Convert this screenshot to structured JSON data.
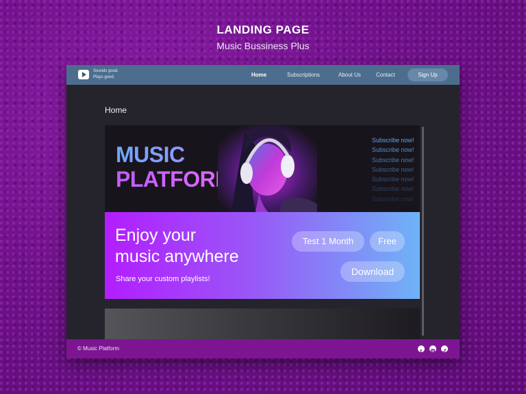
{
  "header": {
    "title": "LANDING PAGE",
    "subtitle": "Music Bussiness Plus"
  },
  "nav": {
    "tagline_line1": "Sounds good.",
    "tagline_line2": "Plays good.",
    "links": [
      "Home",
      "Subscriptions",
      "About Us",
      "Contact"
    ],
    "signup": "Sign Up"
  },
  "page": {
    "heading": "Home"
  },
  "hero": {
    "title_line1": "MUSIC",
    "title_line2": "PLATFORM",
    "subscribe": [
      "Subscribe now!",
      "Subscribe now!",
      "Subscribe now!",
      "Subscribe now!",
      "Subscribe now!",
      "Subscribe now!",
      "Subscribe now!"
    ],
    "tagline_line1": "Enjoy your",
    "tagline_line2": "music anywhere",
    "share": "Share your custom playlists!",
    "btn_test": "Test 1 Month",
    "btn_free": "Free",
    "btn_download": "Download"
  },
  "footer": {
    "copyright": "© Music Platform",
    "social_icons": [
      "facebook-icon",
      "instagram-icon",
      "tiktok-icon"
    ]
  },
  "colors": {
    "nav": "#4c6d8e",
    "footer": "#7d1592",
    "accent_blue": "#5fa6e6",
    "accent_purple": "#b31dff"
  }
}
